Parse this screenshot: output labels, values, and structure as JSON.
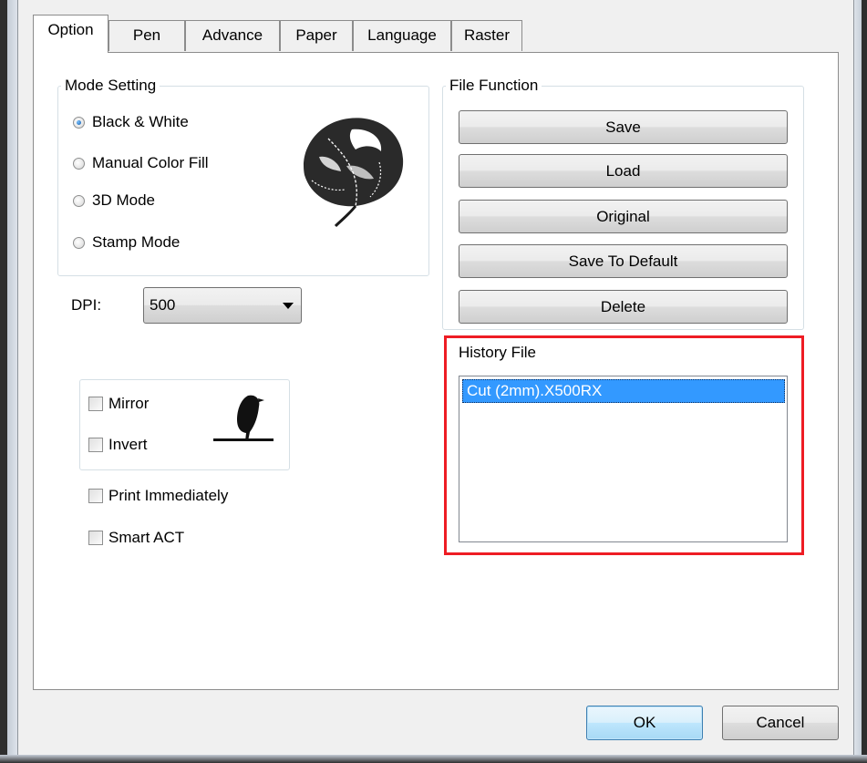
{
  "tabs": [
    "Option",
    "Pen",
    "Advance",
    "Paper",
    "Language",
    "Raster"
  ],
  "active_tab": "Option",
  "mode_setting": {
    "title": "Mode Setting",
    "options": [
      "Black & White",
      "Manual Color Fill",
      "3D Mode",
      "Stamp Mode"
    ],
    "selected": "Black & White"
  },
  "dpi": {
    "label": "DPI:",
    "value": "500"
  },
  "image_options": {
    "mirror": "Mirror",
    "invert": "Invert"
  },
  "print_immediately": "Print Immediately",
  "smart_act": "Smart ACT",
  "file_function": {
    "title": "File Function",
    "buttons": [
      "Save",
      "Load",
      "Original",
      "Save To Default",
      "Delete"
    ]
  },
  "history": {
    "title": "History File",
    "items": [
      "Cut  (2mm).X500RX"
    ]
  },
  "footer": {
    "ok": "OK",
    "cancel": "Cancel"
  },
  "colors": {
    "selection": "#3399ff",
    "highlight": "#ee1c24"
  },
  "icons": {
    "mode_preview": "leaf-icon",
    "mirror_preview": "bird-icon"
  }
}
